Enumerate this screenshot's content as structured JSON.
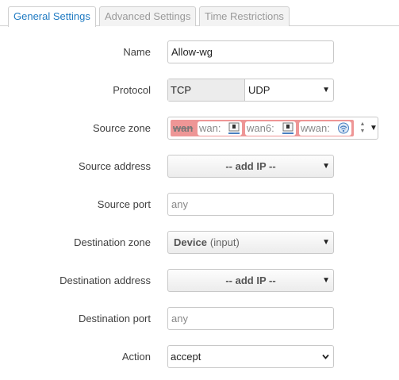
{
  "tabs": [
    {
      "label": "General Settings",
      "active": true
    },
    {
      "label": "Advanced Settings",
      "active": false
    },
    {
      "label": "Time Restrictions",
      "active": false
    }
  ],
  "fields": {
    "name": {
      "label": "Name",
      "value": "Allow-wg"
    },
    "protocol": {
      "label": "Protocol",
      "selected": [
        "TCP",
        "UDP"
      ]
    },
    "source_zone": {
      "label": "Source zone",
      "zone_name": "wan",
      "networks": [
        {
          "label": "wan:",
          "icon": "ethernet-port-icon"
        },
        {
          "label": "wan6:",
          "icon": "ethernet-port-icon"
        },
        {
          "label": "wwan:",
          "icon": "wireless-icon"
        }
      ]
    },
    "source_address": {
      "label": "Source address",
      "value": "-- add IP --"
    },
    "source_port": {
      "label": "Source port",
      "placeholder": "any"
    },
    "destination_zone": {
      "label": "Destination zone",
      "value": "Device",
      "sub": "(input)"
    },
    "destination_address": {
      "label": "Destination address",
      "value": "-- add IP --"
    },
    "destination_port": {
      "label": "Destination port",
      "placeholder": "any"
    },
    "action": {
      "label": "Action",
      "value": "accept"
    }
  },
  "colors": {
    "active_tab_text": "#1f7ac2",
    "zone_badge": "#ee9696",
    "border": "#c8c8c8"
  }
}
